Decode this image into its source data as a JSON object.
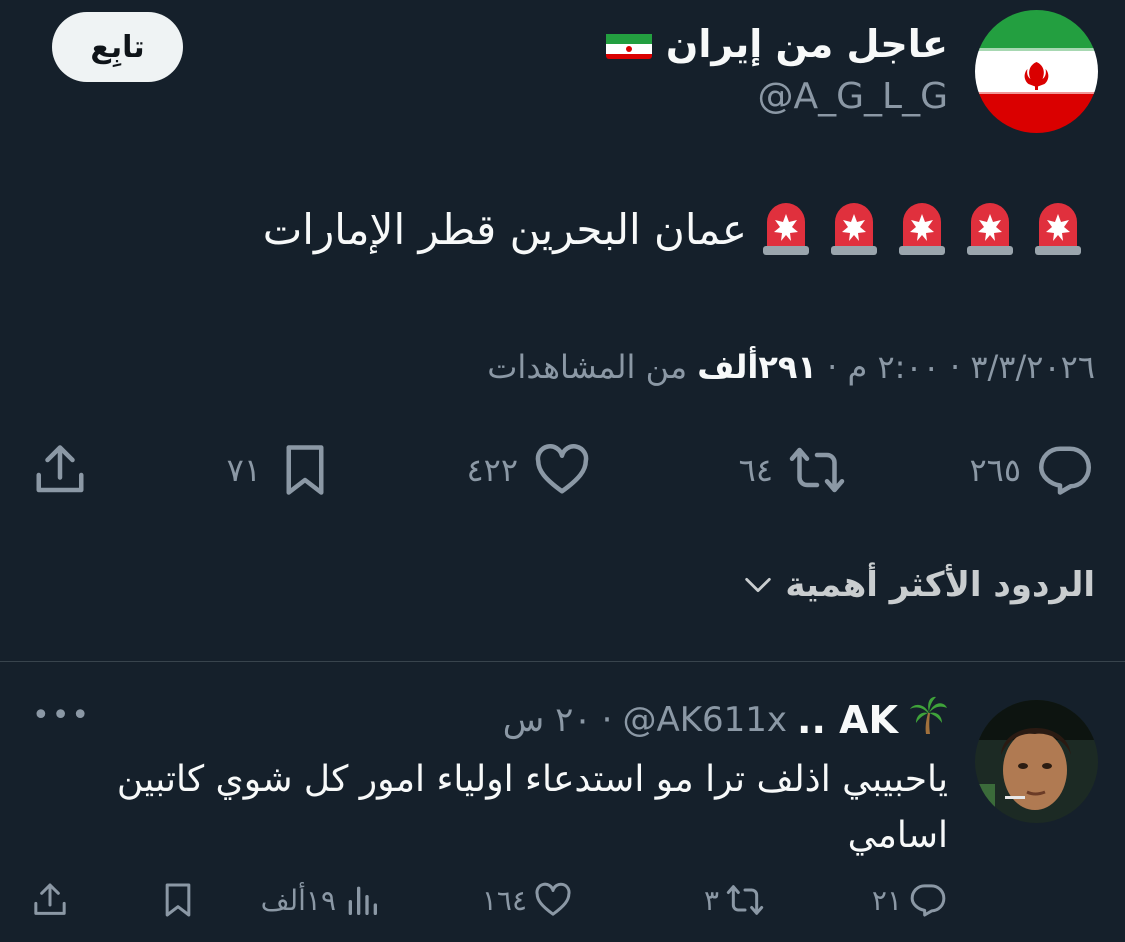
{
  "tweet": {
    "follow_label": "تابِع",
    "display_name": "عاجل من إيران",
    "handle": "@A_G_L_G",
    "text": "عمان البحرين قطر الإمارات",
    "date": "٣/٣/٢٠٢٦",
    "time": "٢:٠٠ م",
    "views": "٢٩١ألف",
    "views_suffix": "من المشاهدات",
    "replies": "٢٦٥",
    "retweets": "٦٤",
    "likes": "٤٢٢",
    "bookmarks": "٧١"
  },
  "sort": {
    "label": "الردود الأكثر أهمية"
  },
  "reply": {
    "name": "AK ..",
    "handle": "@AK611x",
    "time": "٢٠ س",
    "text": "ياحبيبي اذلف ترا مو استدعاء اولياء امور كل شوي كاتبين اسامي",
    "replies": "٢١",
    "retweets": "٣",
    "likes": "١٦٤",
    "views": "١٩ألف"
  },
  "colors": {
    "background": "#15202b",
    "text_primary": "#f7f9f9",
    "text_secondary": "#8b98a5",
    "button_bg": "#eff3f4"
  },
  "icons": [
    "iran-flag-icon",
    "siren-icon",
    "reply-icon",
    "retweet-icon",
    "like-icon",
    "bookmark-icon",
    "share-icon",
    "chevron-down-icon",
    "palm-tree-icon",
    "views-icon",
    "more-icon"
  ]
}
